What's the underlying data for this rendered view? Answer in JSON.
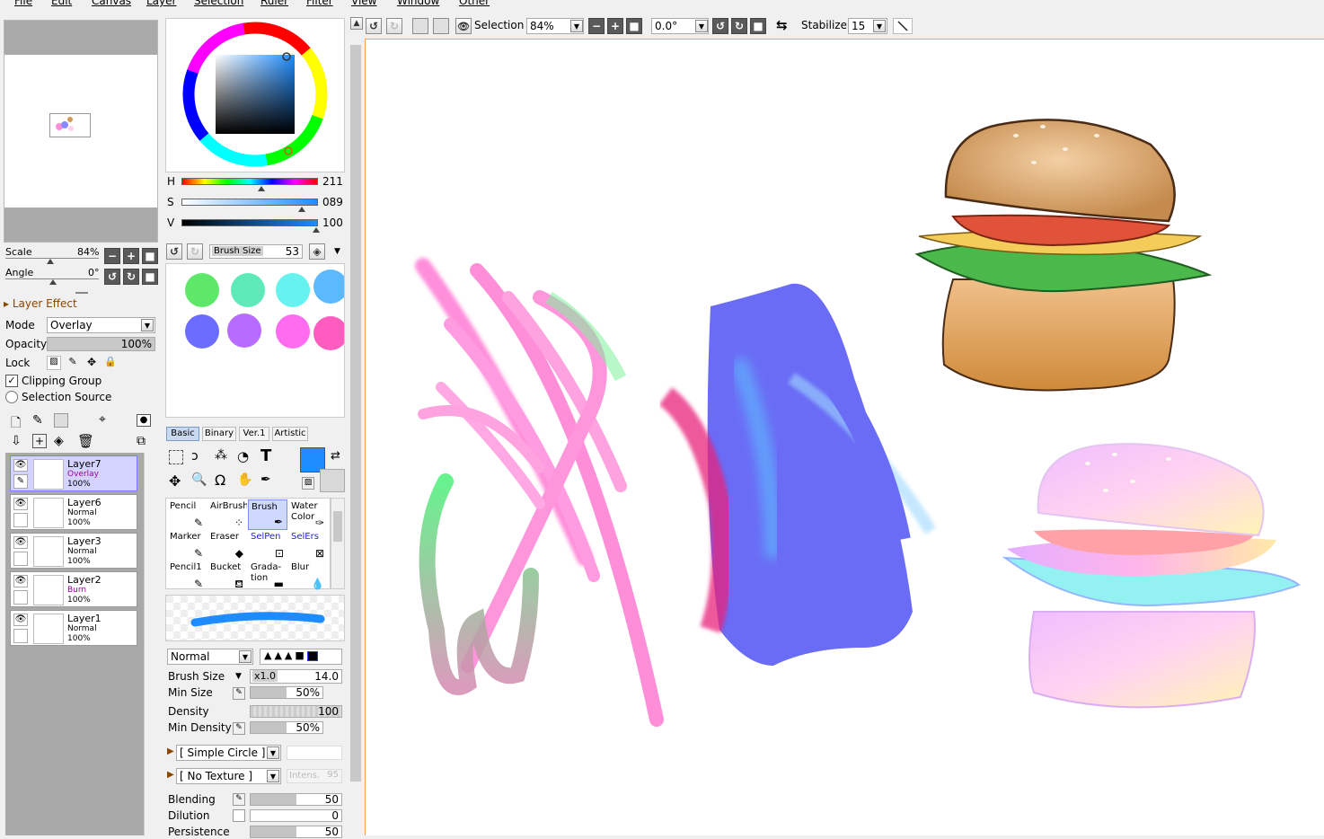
{
  "menu": [
    "File",
    "Edit",
    "Canvas",
    "Layer",
    "Selection",
    "Ruler",
    "Filter",
    "View",
    "Window",
    "Other"
  ],
  "navigator": {
    "scale_label": "Scale",
    "scale_value": "84%",
    "angle_label": "Angle",
    "angle_value": "0°"
  },
  "layer_effect": {
    "title": "Layer Effect",
    "mode_label": "Mode",
    "mode_value": "Overlay",
    "opacity_label": "Opacity",
    "opacity_value": "100%",
    "lock_label": "Lock",
    "clipping_group": "Clipping Group",
    "clipping_checked": true,
    "selection_source": "Selection Source"
  },
  "layers": [
    {
      "name": "Layer7",
      "mode": "Overlay",
      "opacity": "100%",
      "selected": true
    },
    {
      "name": "Layer6",
      "mode": "Normal",
      "opacity": "100%",
      "selected": false
    },
    {
      "name": "Layer3",
      "mode": "Normal",
      "opacity": "100%",
      "selected": false
    },
    {
      "name": "Layer2",
      "mode": "Burn",
      "opacity": "100%",
      "selected": false
    },
    {
      "name": "Layer1",
      "mode": "Normal",
      "opacity": "100%",
      "selected": false
    }
  ],
  "color": {
    "h_label": "H",
    "h_value": "211",
    "h_fraction": 0.59,
    "s_label": "S",
    "s_value": "089",
    "s_fraction": 0.89,
    "v_label": "V",
    "v_value": "100",
    "v_fraction": 1.0,
    "current": "#1e8cff"
  },
  "brush_size_bar": {
    "label": "Brush Size",
    "value": "53"
  },
  "swatches": [
    "#5de86a",
    "#5eeab8",
    "#66f3f0",
    "#5cb8ff",
    "#6c6cff",
    "#b86cff",
    "#ff6cf0",
    "#ff5cc0"
  ],
  "tool_tabs": [
    "Basic",
    "Binary",
    "Ver.1",
    "Artistic"
  ],
  "tools": [
    {
      "name": "Pencil",
      "selected": false
    },
    {
      "name": "AirBrush",
      "selected": false
    },
    {
      "name": "Brush",
      "selected": true
    },
    {
      "name": "Water\nColor",
      "selected": false
    },
    {
      "name": "Marker",
      "selected": false
    },
    {
      "name": "Eraser",
      "selected": false
    },
    {
      "name": "SelPen",
      "selected": false
    },
    {
      "name": "SelErs",
      "selected": false
    },
    {
      "name": "Pencil1",
      "selected": false
    },
    {
      "name": "Bucket",
      "selected": false
    },
    {
      "name": "Grada-\ntion",
      "selected": false
    },
    {
      "name": "Blur",
      "selected": false
    }
  ],
  "brush": {
    "blend_mode": "Normal",
    "size_label": "Brush Size",
    "size_mult": "x1.0",
    "size_value": "14.0",
    "min_size_label": "Min Size",
    "min_size_value": "50%",
    "density_label": "Density",
    "density_value": "100",
    "min_density_label": "Min Density",
    "min_density_value": "50%",
    "shape": "[ Simple Circle ]",
    "texture": "[ No Texture ]",
    "intens_label": "Intens.",
    "intens_value": "95",
    "blending_label": "Blending",
    "blending_value": "50",
    "dilution_label": "Dilution",
    "dilution_value": "0",
    "persistence_label": "Persistence",
    "persistence_value": "50"
  },
  "toolbar": {
    "selection_label": "Selection",
    "zoom_value": "84%",
    "angle_value": "0.0°",
    "stabilizer_label": "Stabilizer",
    "stabilizer_value": "15"
  }
}
